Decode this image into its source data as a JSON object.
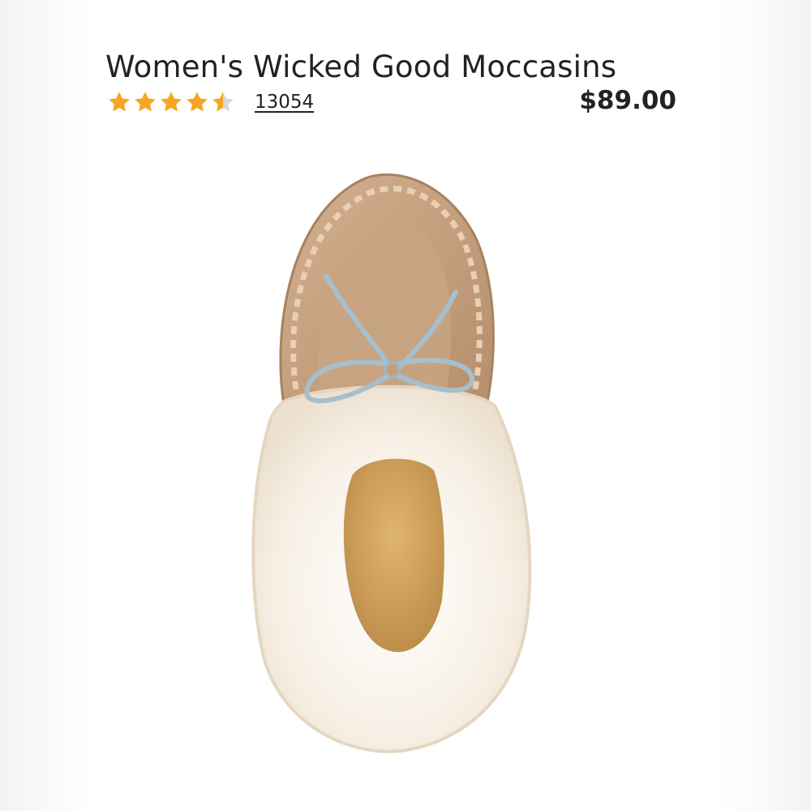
{
  "product": {
    "title": "Women's Wicked Good Moccasins",
    "rating": 4.5,
    "rating_max": 5,
    "review_count": "13054",
    "price": "$89.00",
    "image": {
      "subject": "moccasin-slipper",
      "colors": {
        "suede": "#c6a07e",
        "fur": "#f4ece0",
        "lining": "#d2a05e",
        "lace": "#9fb8c8"
      }
    }
  },
  "icons": {
    "star": "star-icon"
  },
  "colors": {
    "star_fill": "#f5a623",
    "star_empty": "#d9d9d9",
    "text": "#222222"
  }
}
